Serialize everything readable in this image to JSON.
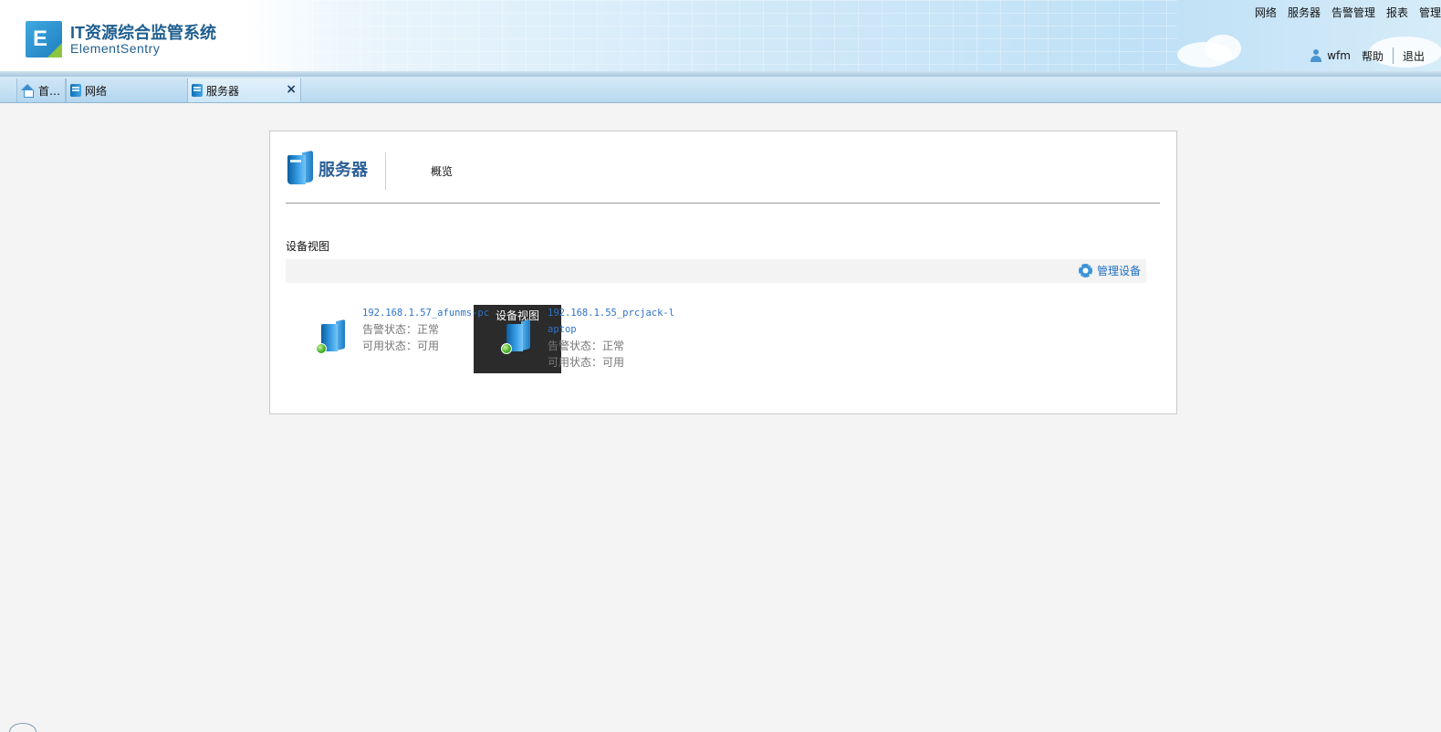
{
  "header": {
    "logo_letter": "E",
    "title": "IT资源综合监管系统",
    "subtitle": "ElementSentry",
    "nav": [
      "网络",
      "服务器",
      "告警管理",
      "报表",
      "管理"
    ],
    "user": "wfm",
    "help": "帮助",
    "logout": "退出"
  },
  "tabs": [
    {
      "label": "首…",
      "icon": "home-icon"
    },
    {
      "label": "网络",
      "icon": "server-icon"
    },
    {
      "label": "服务器",
      "icon": "server-icon",
      "close": "×",
      "active": true
    }
  ],
  "panel": {
    "title": "服务器",
    "tab_overview": "概览",
    "tab_device_view": "设备视图",
    "section_label": "设备视图",
    "manage_devices": "管理设备"
  },
  "devices": [
    {
      "name": "192.168.1.57_afunms-pc",
      "alarm_status": "告警状态：正常",
      "availability": "可用状态：可用",
      "status_color": "#3fae23"
    },
    {
      "name": "192.168.1.55_prcjack-laptop",
      "alarm_status": "告警状态：正常",
      "availability": "可用状态：可用",
      "status_color": "#3fae23"
    }
  ],
  "colors": {
    "link": "#2f73c6",
    "active_tab_bg": "#2b2b2b",
    "title": "#2a5e95"
  }
}
